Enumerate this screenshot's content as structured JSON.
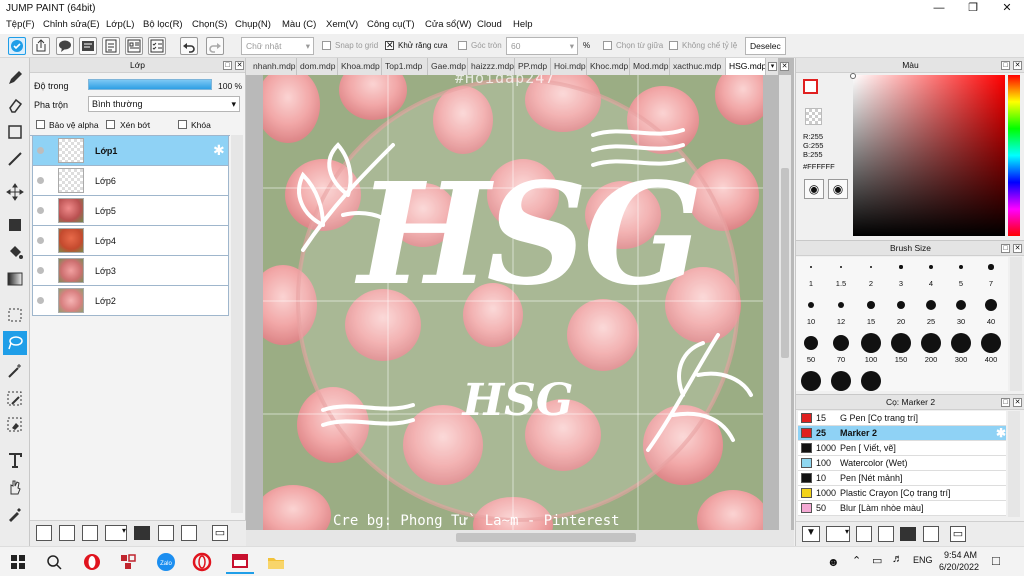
{
  "window": {
    "title": "JUMP PAINT (64bit)"
  },
  "menu": [
    "Tệp(F)",
    "Chỉnh sửa(E)",
    "Lớp(L)",
    "Bộ lọc(R)",
    "Chọn(S)",
    "Chụp(N)",
    "Màu (C)",
    "Xem(V)",
    "Công cụ(T)",
    "Cửa sổ(W)",
    "Cloud",
    "Help"
  ],
  "toolbar": {
    "shape_select": "Chữ nhật",
    "snap_grid": "Snap to grid",
    "antialias": "Khử răng cưa",
    "corner_label": "Góc tròn",
    "corner_value": "60",
    "percent": "%",
    "select_center": "Chọn từ giữa",
    "no_ratio": "Không chế tỷ lệ",
    "deselect": "Deselec"
  },
  "layer_panel": {
    "title": "Lớp",
    "opacity_label": "Độ trong",
    "opacity_value": "100 %",
    "opacity_level": 1.0,
    "blend_label": "Pha trộn",
    "blend_value": "Bình thường",
    "protect_alpha": "Bảo vệ alpha",
    "clip": "Xén bớt",
    "lock": "Khóa",
    "layers": [
      {
        "name": "Lớp1",
        "selected": true
      },
      {
        "name": "Lớp6",
        "selected": false
      },
      {
        "name": "Lớp5",
        "selected": false
      },
      {
        "name": "Lớp4",
        "selected": false
      },
      {
        "name": "Lớp3",
        "selected": false
      },
      {
        "name": "Lớp2",
        "selected": false
      }
    ]
  },
  "tabs": [
    "nhanh.mdp",
    "dom.mdp",
    "Khoa.mdp",
    "Top1.mdp",
    "Gae.mdp",
    "haizzz.mdp",
    "PP.mdp",
    "Hoi.mdp",
    "Khoc.mdp",
    "Mod.mdp",
    "xacthuc.mdp",
    "HSG.mdp"
  ],
  "active_tab": "HSG.mdp",
  "canvas": {
    "hashtag": "#Hoidap247",
    "main_text": "HSG",
    "sub_text": "HSG",
    "credit": "Cre bg: Phong Tư` La~m - Pinterest"
  },
  "color_panel": {
    "title": "Màu",
    "r": "R:255",
    "g": "G:255",
    "b": "B:255",
    "hex": "#FFFFFF"
  },
  "brush_panel": {
    "title": "Brush Size",
    "sizes": [
      "1",
      "1.5",
      "2",
      "3",
      "4",
      "5",
      "7",
      "10",
      "12",
      "15",
      "20",
      "25",
      "30",
      "40",
      "50",
      "70",
      "100",
      "150",
      "200",
      "300",
      "400"
    ]
  },
  "pen_panel": {
    "title": "Cọ: Marker 2",
    "items": [
      {
        "size": "15",
        "name": "G Pen [Cọ trang trí]",
        "color": "#e02020"
      },
      {
        "size": "25",
        "name": "Marker 2",
        "color": "#e02020",
        "selected": true
      },
      {
        "size": "1000",
        "name": "Pen [ Viết, vẽ]",
        "color": "#111111"
      },
      {
        "size": "100",
        "name": "Watercolor (Wet)",
        "color": "#8fd7f0"
      },
      {
        "size": "10",
        "name": "Pen [Nét mảnh]",
        "color": "#111111"
      },
      {
        "size": "1000",
        "name": "Plastic Crayon [Cọ trang trí]",
        "color": "#f2d21a"
      },
      {
        "size": "50",
        "name": "Blur [Làm nhòe màu]",
        "color": "#f4a9d4"
      }
    ]
  },
  "taskbar": {
    "lang": "ENG",
    "time": "9:54 AM",
    "date": "6/20/2022"
  },
  "colors": {
    "accent": "#1f9ee8",
    "selected_row": "#8fd2f5"
  }
}
